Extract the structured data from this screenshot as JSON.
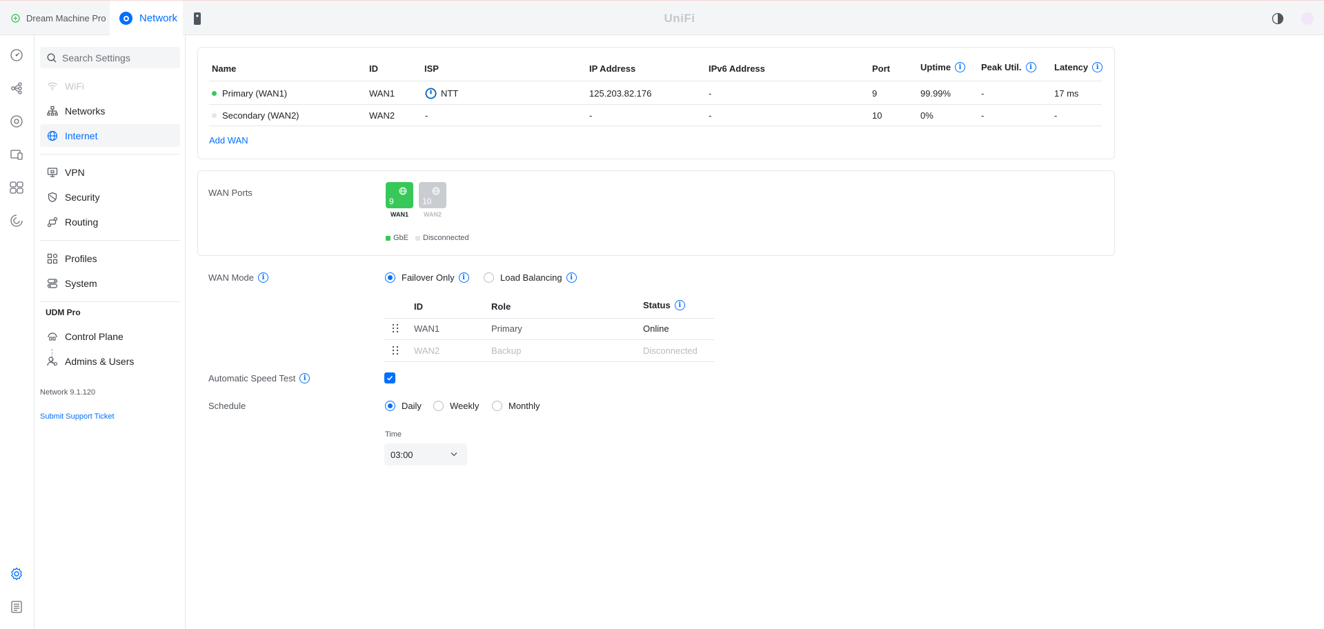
{
  "topbar": {
    "console_tab": "Dream Machine Pro",
    "app_tab": "Network",
    "brand": "UniFi"
  },
  "search": {
    "placeholder": "Search Settings"
  },
  "sidebar": {
    "items": [
      {
        "label": "WiFi"
      },
      {
        "label": "Networks"
      },
      {
        "label": "Internet"
      },
      {
        "label": "VPN"
      },
      {
        "label": "Security"
      },
      {
        "label": "Routing"
      },
      {
        "label": "Profiles"
      },
      {
        "label": "System"
      }
    ],
    "group_label": "UDM Pro",
    "group_items": [
      {
        "label": "Control Plane"
      },
      {
        "label": "Admins & Users"
      }
    ],
    "version": "Network 9.1.120",
    "support_link": "Submit Support Ticket"
  },
  "wan_table": {
    "headers": {
      "name": "Name",
      "id": "ID",
      "isp": "ISP",
      "ip": "IP Address",
      "ipv6": "IPv6 Address",
      "port": "Port",
      "uptime": "Uptime",
      "peak": "Peak Util.",
      "latency": "Latency"
    },
    "rows": [
      {
        "name": "Primary (WAN1)",
        "id": "WAN1",
        "isp": "NTT",
        "ip": "125.203.82.176",
        "ipv6": "-",
        "port": "9",
        "uptime": "99.99%",
        "peak": "-",
        "latency": "17 ms",
        "status_color": "#38c85a"
      },
      {
        "name": "Secondary (WAN2)",
        "id": "WAN2",
        "isp": "-",
        "ip": "-",
        "ipv6": "-",
        "port": "10",
        "uptime": "0%",
        "peak": "-",
        "latency": "-",
        "status_color": "#e4e6e9"
      }
    ],
    "add_wan": "Add WAN"
  },
  "wan_ports": {
    "label": "WAN Ports",
    "ports": [
      {
        "number": "9",
        "name": "WAN1",
        "color": "#38c85a"
      },
      {
        "number": "10",
        "name": "WAN2",
        "color": "#c9ccd1"
      }
    ],
    "legend": [
      {
        "label": "GbE",
        "color": "#38c85a"
      },
      {
        "label": "Disconnected",
        "color": "#e4e6e9"
      }
    ]
  },
  "wan_mode": {
    "label": "WAN Mode",
    "options": [
      "Failover Only",
      "Load Balancing"
    ],
    "selected": "Failover Only",
    "table": {
      "headers": {
        "id": "ID",
        "role": "Role",
        "status": "Status"
      },
      "rows": [
        {
          "id": "WAN1",
          "role": "Primary",
          "status": "Online"
        },
        {
          "id": "WAN2",
          "role": "Backup",
          "status": "Disconnected"
        }
      ]
    }
  },
  "speed_test": {
    "label": "Automatic Speed Test",
    "checked": true
  },
  "schedule": {
    "label": "Schedule",
    "options": [
      "Daily",
      "Weekly",
      "Monthly"
    ],
    "selected": "Daily",
    "time_label": "Time",
    "time_value": "03:00"
  },
  "colors": {
    "accent": "#006fff",
    "online": "#38c85a",
    "muted": "#c4c8ce"
  }
}
